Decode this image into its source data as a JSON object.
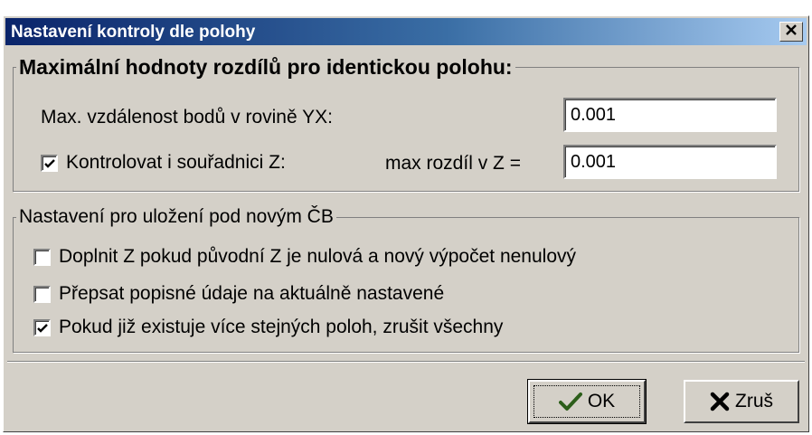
{
  "window": {
    "title": "Nastavení kontroly dle polohy",
    "close_glyph": "✕"
  },
  "group_identical": {
    "legend": "Maximální hodnoty rozdílů pro identickou polohu:",
    "max_distance_label": "Max. vzdálenost bodů v rovině YX:",
    "max_distance_value": "0.001",
    "check_z_label": "Kontrolovat i souřadnici Z:",
    "check_z_checked": true,
    "max_z_label": "max rozdíl v Z =",
    "max_z_value": "0.001"
  },
  "group_save": {
    "legend": "Nastavení pro uložení pod novým ČB",
    "options": [
      {
        "label": "Doplnit Z pokud původní Z je nulová a nový výpočet nenulový",
        "checked": false
      },
      {
        "label": "Přepsat popisné údaje na aktuálně nastavené",
        "checked": false
      },
      {
        "label": "Pokud již existuje více stejných poloh, zrušit všechny",
        "checked": true
      }
    ]
  },
  "buttons": {
    "ok_label": "OK",
    "ok_icon": "checkmark-icon",
    "cancel_label": "Zruš",
    "cancel_icon": "x-icon"
  },
  "colors": {
    "title_gradient_start": "#0a246a",
    "title_gradient_end": "#a6caf0",
    "face": "#d4d0c8",
    "ok_icon_color": "#2c5e1a"
  }
}
